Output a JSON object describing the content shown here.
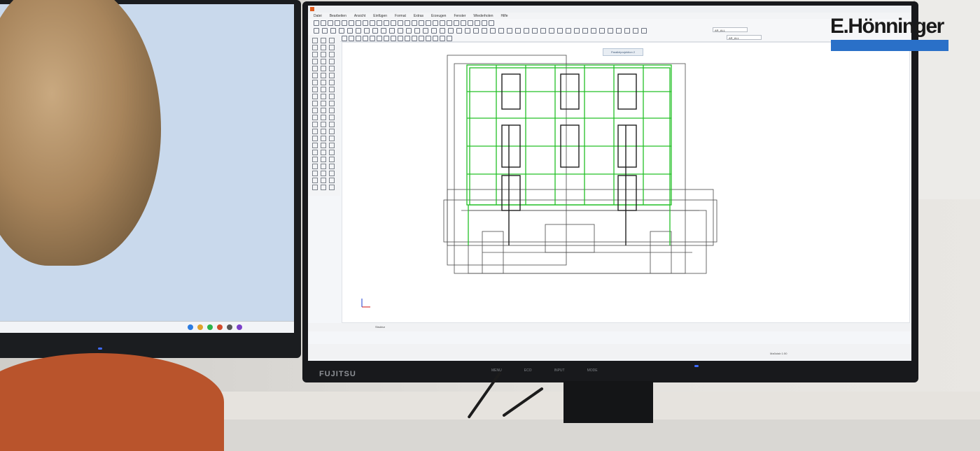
{
  "logo": {
    "text": "E.Hönninger",
    "bar_color": "#2a70c8"
  },
  "monitor_right": {
    "brand": "FUJITSU",
    "buttons": [
      "MENU",
      "ECO",
      "INPUT",
      "MODE"
    ]
  },
  "app": {
    "menu": [
      "Datei",
      "Bearbeiten",
      "Ansicht",
      "Einfügen",
      "Format",
      "Extras",
      "Erzeugen",
      "Fenster",
      "Wiederholen",
      "Hilfe"
    ],
    "fields": {
      "layer_1": "AR_ALL",
      "layer_2": "AR_ALL"
    },
    "view_tag": "Parallelprojektion 2",
    "bottom_label": "Struktur",
    "status_right": "Maßstab 1:50"
  },
  "colors": {
    "wireframe_dark": "#1e1e1e",
    "wireframe_green": "#24c027",
    "accent_orange": "#d7542a"
  }
}
